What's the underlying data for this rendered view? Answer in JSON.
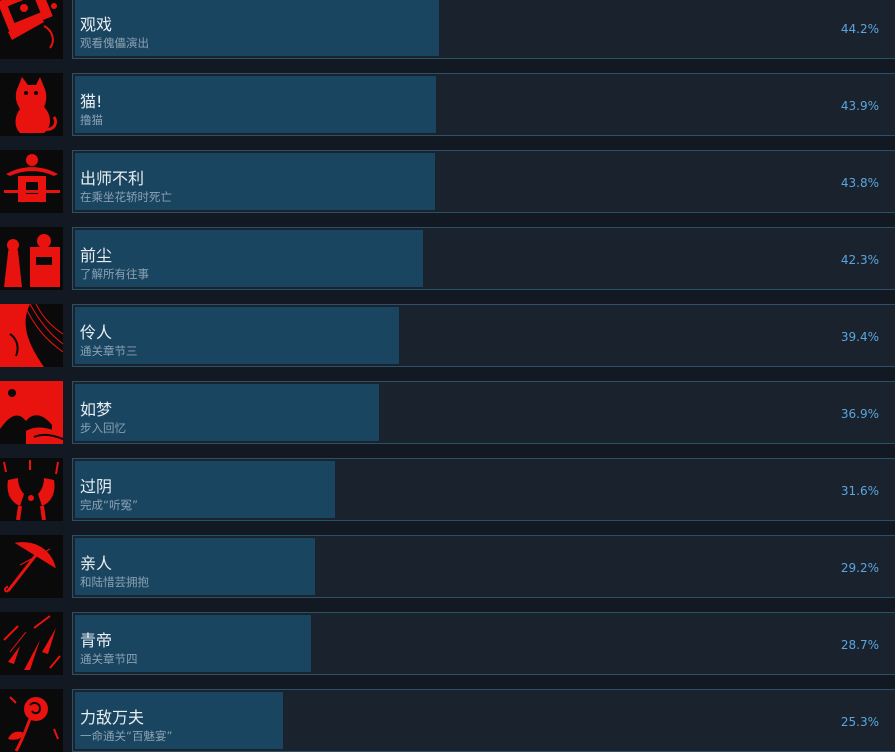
{
  "colors": {
    "background": "#121922",
    "panel": "#1a222d",
    "bar": "#1a4560",
    "border": "#2b5167",
    "percent": "#5aa6df",
    "icon_red": "#e8120e"
  },
  "achievements": [
    {
      "title": "观戏",
      "desc": "观看傀儡演出",
      "percent_text": "44.2%",
      "percent": 44.2,
      "icon": "ticket-icon"
    },
    {
      "title": "猫!",
      "desc": "撸猫",
      "percent_text": "43.9%",
      "percent": 43.9,
      "icon": "cat-icon"
    },
    {
      "title": "出师不利",
      "desc": "在乘坐花轿时死亡",
      "percent_text": "43.8%",
      "percent": 43.8,
      "icon": "sedan-chair-icon"
    },
    {
      "title": "前尘",
      "desc": "了解所有往事",
      "percent_text": "42.3%",
      "percent": 42.3,
      "icon": "figures-icon"
    },
    {
      "title": "伶人",
      "desc": "通关章节三",
      "percent_text": "39.4%",
      "percent": 39.4,
      "icon": "performer-icon"
    },
    {
      "title": "如梦",
      "desc": "步入回忆",
      "percent_text": "36.9%",
      "percent": 36.9,
      "icon": "landscape-icon"
    },
    {
      "title": "过阴",
      "desc": "完成“听冤”",
      "percent_text": "31.6%",
      "percent": 31.6,
      "icon": "hands-icon"
    },
    {
      "title": "亲人",
      "desc": "和陆惜芸拥抱",
      "percent_text": "29.2%",
      "percent": 29.2,
      "icon": "umbrella-icon"
    },
    {
      "title": "青帝",
      "desc": "通关章节四",
      "percent_text": "28.7%",
      "percent": 28.7,
      "icon": "petals-icon"
    },
    {
      "title": "力敌万夫",
      "desc": "一命通关“百魅宴”",
      "percent_text": "25.3%",
      "percent": 25.3,
      "icon": "rose-icon"
    }
  ]
}
